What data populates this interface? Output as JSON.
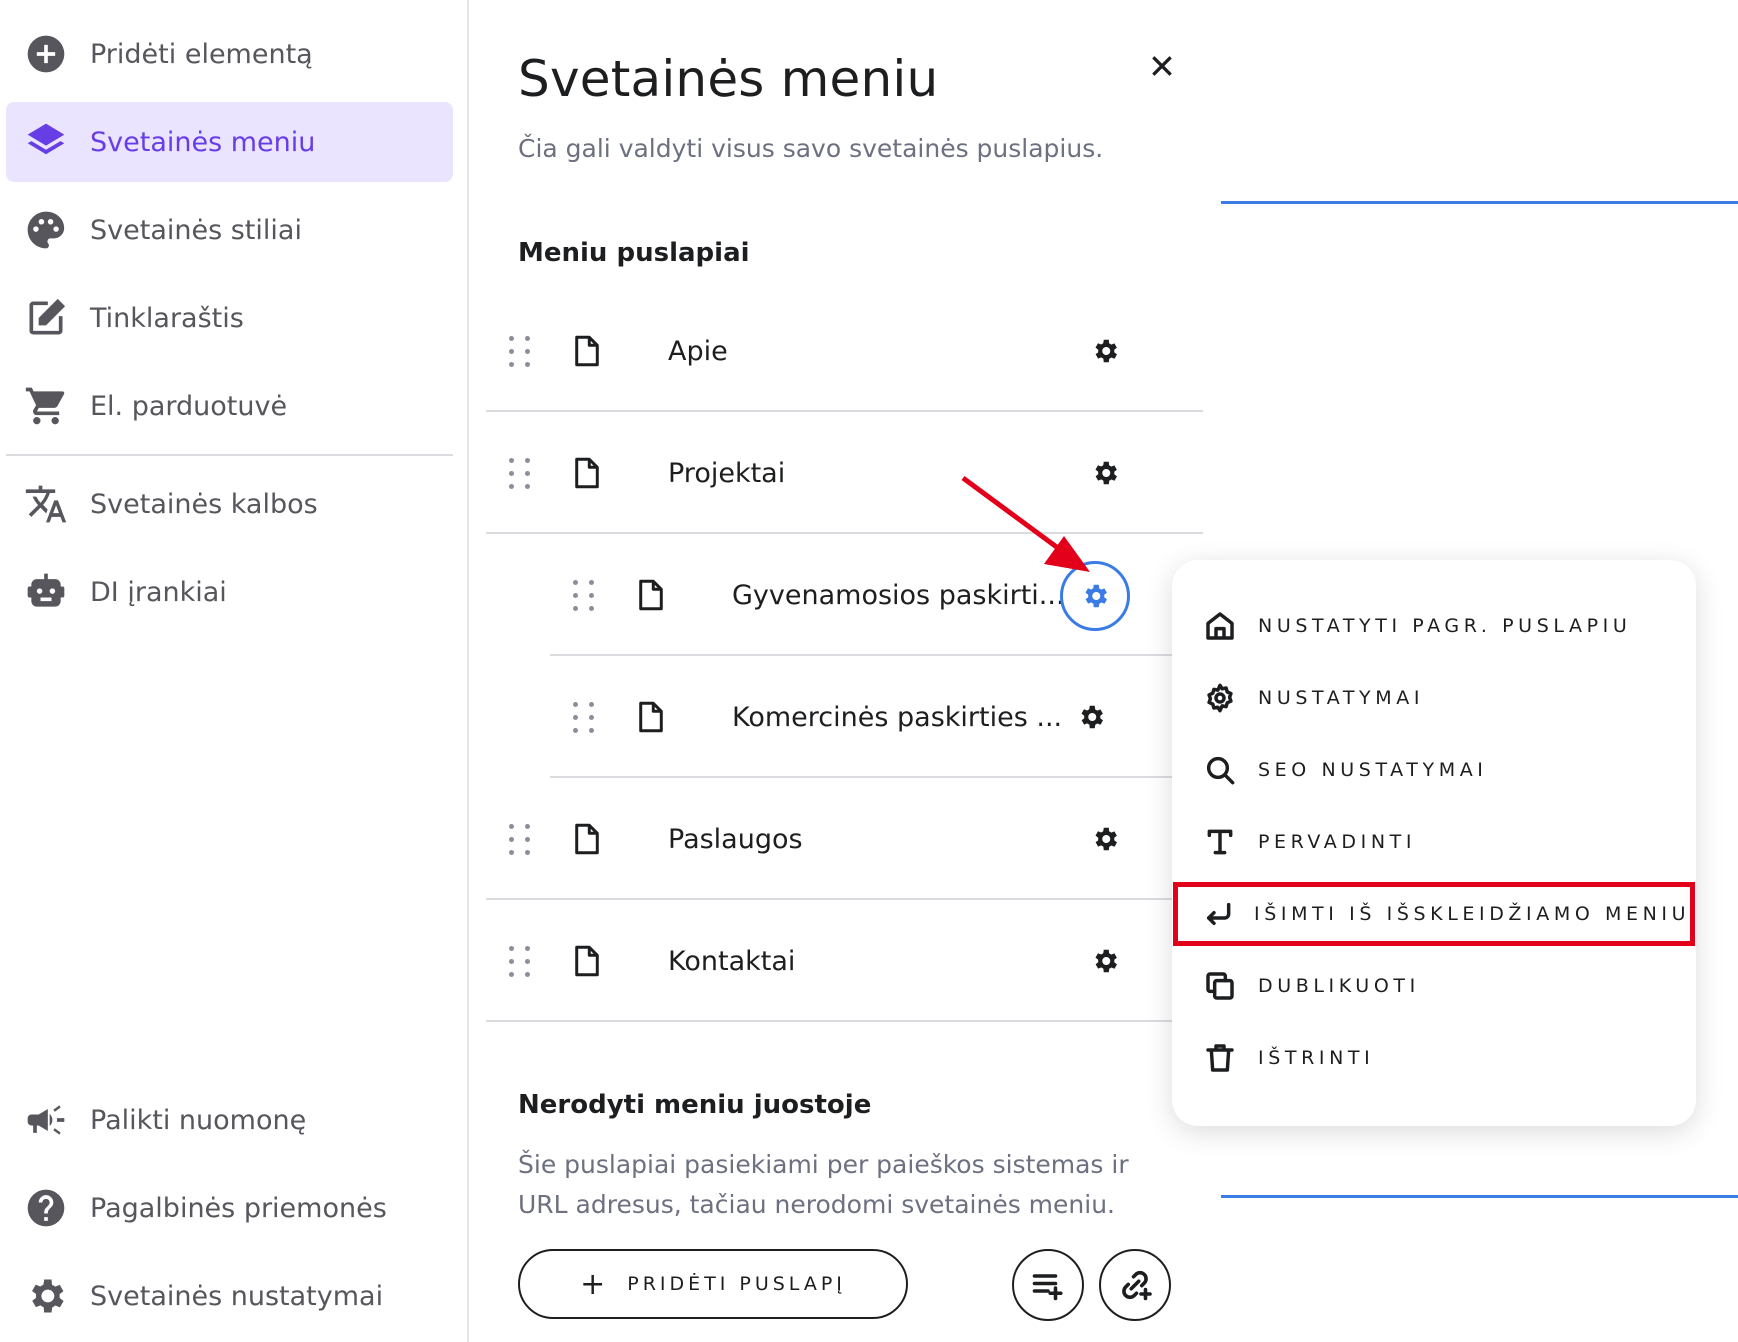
{
  "sidebar": {
    "items": [
      {
        "label": "Pridėti elementą",
        "icon": "add-circle-icon"
      },
      {
        "label": "Svetainės meniu",
        "icon": "layers-icon",
        "active": true
      },
      {
        "label": "Svetainės stiliai",
        "icon": "palette-icon"
      },
      {
        "label": "Tinklaraštis",
        "icon": "edit-icon"
      },
      {
        "label": "El. parduotuvė",
        "icon": "cart-icon"
      },
      {
        "label": "Svetainės kalbos",
        "icon": "translate-icon"
      },
      {
        "label": "DI įrankiai",
        "icon": "robot-icon"
      }
    ],
    "bottom_items": [
      {
        "label": "Palikti nuomonę",
        "icon": "megaphone-icon"
      },
      {
        "label": "Pagalbinės priemonės",
        "icon": "help-icon"
      },
      {
        "label": "Svetainės nustatymai",
        "icon": "gear-icon"
      }
    ]
  },
  "panel": {
    "title": "Svetainės meniu",
    "subtitle": "Čia gali valdyti visus savo svetainės puslapius.",
    "menu_section_title": "Meniu puslapiai",
    "pages": [
      {
        "name": "Apie"
      },
      {
        "name": "Projektai"
      },
      {
        "name": "Gyvenamosios paskirti...",
        "child": true
      },
      {
        "name": "Komercinės paskirties ...",
        "child": true
      },
      {
        "name": "Paslaugos"
      },
      {
        "name": "Kontaktai"
      }
    ],
    "hidden_section_title": "Nerodyti meniu juostoje",
    "hidden_section_text": "Šie puslapiai pasiekiami per paieškos sistemas ir URL adresus, tačiau nerodomi svetainės meniu.",
    "add_page_label": "PRIDĖTI PUSLAPĮ"
  },
  "context_menu": {
    "items": [
      {
        "label": "NUSTATYTI PAGR. PUSLAPIU",
        "icon": "home-icon"
      },
      {
        "label": "NUSTATYMAI",
        "icon": "gear-icon"
      },
      {
        "label": "SEO NUSTATYMAI",
        "icon": "search-icon"
      },
      {
        "label": "PERVADINTI",
        "icon": "text-icon"
      },
      {
        "label": "IŠIMTI IŠ IŠSKLEIDŽIAMO MENIU",
        "icon": "return-arrow-icon",
        "highlighted": true
      },
      {
        "label": "DUBLIKUOTI",
        "icon": "duplicate-icon"
      },
      {
        "label": "IŠTRINTI",
        "icon": "trash-icon"
      }
    ]
  },
  "colors": {
    "accent": "#673de6",
    "active_bg": "#ebe4ff",
    "focus_blue": "#3a7be6",
    "annotation_red": "#e3001b"
  }
}
